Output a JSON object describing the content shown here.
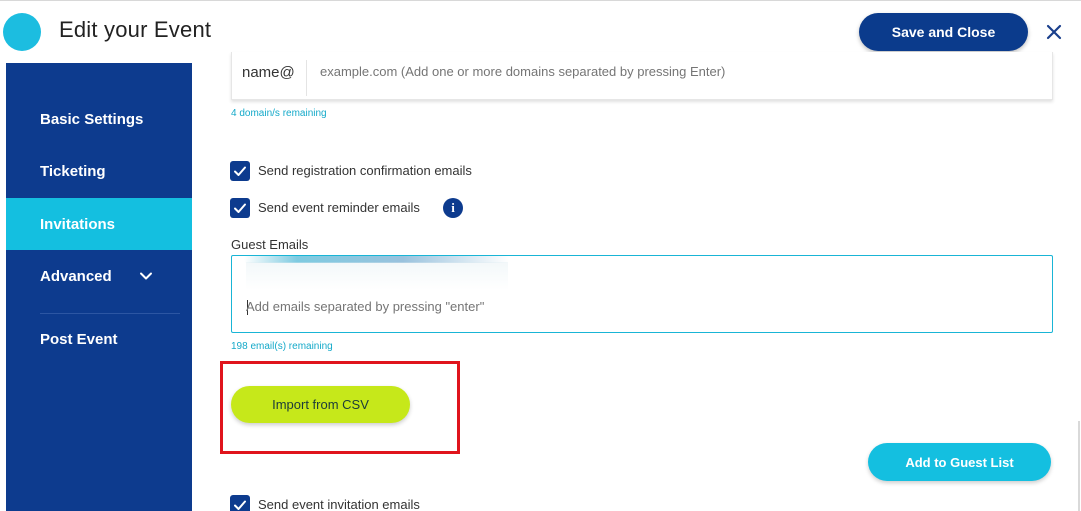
{
  "header": {
    "title": "Edit your Event",
    "save_label": "Save and Close",
    "close_icon": "close-icon",
    "brand_color": "#1cbde0"
  },
  "sidebar": {
    "items": [
      {
        "label": "Basic Settings",
        "active": false
      },
      {
        "label": "Ticketing",
        "active": false
      },
      {
        "label": "Invitations",
        "active": true
      },
      {
        "label": "Advanced",
        "active": false,
        "icon": "chevron-down-icon"
      },
      {
        "label": "Post Event",
        "active": false
      }
    ],
    "bg_color": "#0d3b8e",
    "active_color": "#14bfe0"
  },
  "domains": {
    "prefix": "name@",
    "placeholder": "example.com (Add one or more domains separated by pressing Enter)",
    "remaining": "4 domain/s remaining"
  },
  "options": {
    "registration_confirmation": {
      "label": "Send registration confirmation emails",
      "checked": true
    },
    "event_reminder": {
      "label": "Send event reminder emails",
      "checked": true,
      "info_icon": "info-icon"
    },
    "event_invitation": {
      "label": "Send event invitation emails",
      "checked": true
    }
  },
  "guest_emails": {
    "label": "Guest Emails",
    "placeholder": "Add emails separated by pressing \"enter\"",
    "remaining": "198 email(s) remaining"
  },
  "buttons": {
    "import_csv": "Import from CSV",
    "add_to_guest_list": "Add to Guest List"
  },
  "colors": {
    "highlight": "#e0141c",
    "csv_button": "#c6e81a",
    "primary": "#0b3b8c"
  }
}
